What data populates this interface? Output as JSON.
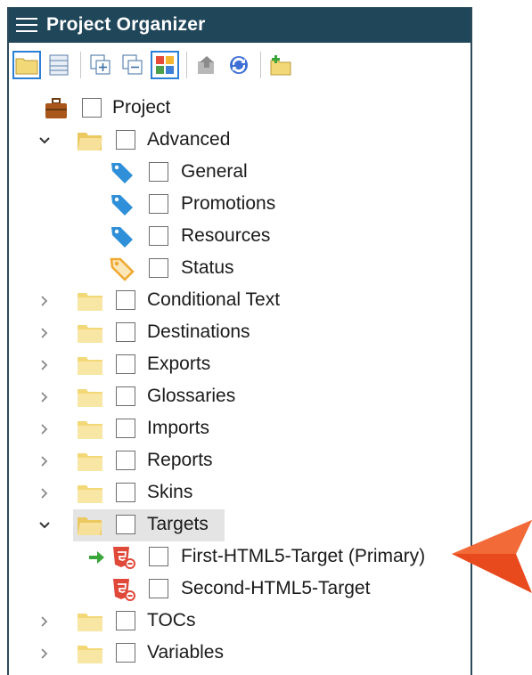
{
  "window": {
    "title": "Project Organizer"
  },
  "colors": {
    "titlebar": "#20465a",
    "selection": "#e4e4e4",
    "folder": "#f3d878",
    "tag_blue": "#2f8fd8",
    "tag_orange": "#f0a830",
    "target_red": "#e0483a",
    "callout": "#e84a1e"
  },
  "toolbar": [
    {
      "name": "open-folder-icon",
      "active": true
    },
    {
      "name": "table-view-icon",
      "active": false
    },
    {
      "name": "expand-all-icon",
      "active": false
    },
    {
      "name": "collapse-all-icon",
      "active": false
    },
    {
      "name": "color-grid-icon",
      "active": true
    },
    {
      "name": "build-icon",
      "active": false
    },
    {
      "name": "refresh-icon",
      "active": false
    },
    {
      "name": "new-folder-icon",
      "active": false
    }
  ],
  "tree": {
    "project": "Project",
    "advanced": "Advanced",
    "general": "General",
    "promotions": "Promotions",
    "resources": "Resources",
    "status": "Status",
    "conditional_text": "Conditional Text",
    "destinations": "Destinations",
    "exports": "Exports",
    "glossaries": "Glossaries",
    "imports": "Imports",
    "reports": "Reports",
    "skins": "Skins",
    "targets": "Targets",
    "first_target": "First-HTML5-Target (Primary)",
    "second_target": "Second-HTML5-Target",
    "tocs": "TOCs",
    "variables": "Variables"
  }
}
